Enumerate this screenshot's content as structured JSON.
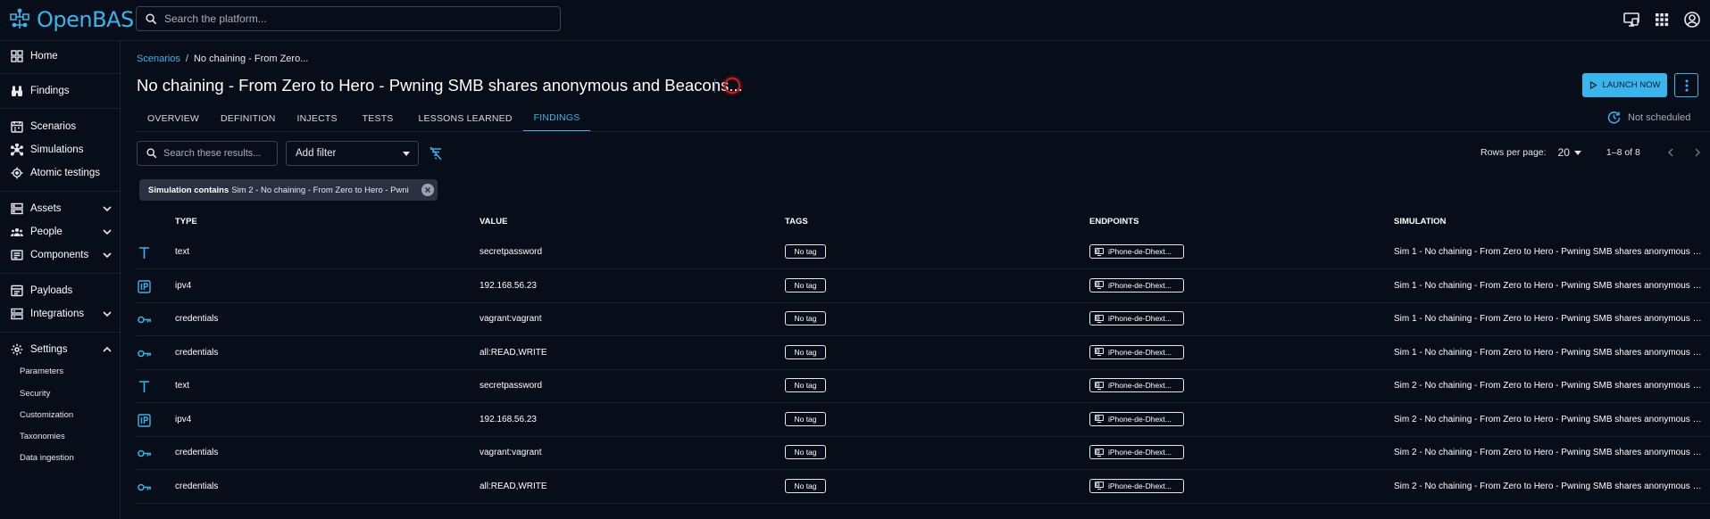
{
  "app": {
    "name": "OpenBAS"
  },
  "search": {
    "placeholder": "Search the platform..."
  },
  "sidebar": {
    "items": [
      {
        "label": "Home"
      },
      {
        "label": "Findings"
      },
      {
        "label": "Scenarios"
      },
      {
        "label": "Simulations"
      },
      {
        "label": "Atomic testings"
      },
      {
        "label": "Assets"
      },
      {
        "label": "People"
      },
      {
        "label": "Components"
      },
      {
        "label": "Payloads"
      },
      {
        "label": "Integrations"
      },
      {
        "label": "Settings"
      }
    ],
    "settings_sub": [
      {
        "label": "Parameters"
      },
      {
        "label": "Security"
      },
      {
        "label": "Customization"
      },
      {
        "label": "Taxonomies"
      },
      {
        "label": "Data ingestion"
      }
    ]
  },
  "breadcrumb": {
    "parent": "Scenarios",
    "current": "No chaining - From Zero..."
  },
  "page": {
    "title": "No chaining - From Zero to Hero - Pwning SMB shares anonymous and Beacons...",
    "launch_label": "LAUNCH NOW",
    "schedule_label": "Not scheduled"
  },
  "tabs": [
    {
      "label": "OVERVIEW"
    },
    {
      "label": "DEFINITION"
    },
    {
      "label": "INJECTS"
    },
    {
      "label": "TESTS"
    },
    {
      "label": "LESSONS LEARNED"
    },
    {
      "label": "FINDINGS",
      "active": true
    }
  ],
  "toolbar": {
    "search_placeholder": "Search these results...",
    "filter_placeholder": "Add filter",
    "rows_per_page_label": "Rows per page:",
    "rows_per_page": "20",
    "range": "1–8 of 8"
  },
  "active_filter": {
    "key": "Simulation contains",
    "value": "Sim 2 - No chaining - From Zero to Hero - Pwni"
  },
  "table": {
    "headers": {
      "type": "TYPE",
      "value": "VALUE",
      "tags": "TAGS",
      "endpoints": "ENDPOINTS",
      "simulation": "SIMULATION"
    },
    "rows": [
      {
        "icon": "text-icon",
        "type": "text",
        "value": "secretpassword",
        "tag": "No tag",
        "endpoint": "iPhone-de-Dhext...",
        "simulation": "Sim 1 - No chaining - From Zero to Hero - Pwning SMB shares anonymous a..."
      },
      {
        "icon": "ip-icon",
        "type": "ipv4",
        "value": "192.168.56.23",
        "tag": "No tag",
        "endpoint": "iPhone-de-Dhext...",
        "simulation": "Sim 1 - No chaining - From Zero to Hero - Pwning SMB shares anonymous a..."
      },
      {
        "icon": "key-icon",
        "type": "credentials",
        "value": "vagrant:vagrant",
        "tag": "No tag",
        "endpoint": "iPhone-de-Dhext...",
        "simulation": "Sim 1 - No chaining - From Zero to Hero - Pwning SMB shares anonymous a..."
      },
      {
        "icon": "key-icon",
        "type": "credentials",
        "value": "all:READ,WRITE",
        "tag": "No tag",
        "endpoint": "iPhone-de-Dhext...",
        "simulation": "Sim 1 - No chaining - From Zero to Hero - Pwning SMB shares anonymous a..."
      },
      {
        "icon": "text-icon",
        "type": "text",
        "value": "secretpassword",
        "tag": "No tag",
        "endpoint": "iPhone-de-Dhext...",
        "simulation": "Sim 2 - No chaining - From Zero to Hero - Pwning SMB shares anonymous a..."
      },
      {
        "icon": "ip-icon",
        "type": "ipv4",
        "value": "192.168.56.23",
        "tag": "No tag",
        "endpoint": "iPhone-de-Dhext...",
        "simulation": "Sim 2 - No chaining - From Zero to Hero - Pwning SMB shares anonymous a..."
      },
      {
        "icon": "key-icon",
        "type": "credentials",
        "value": "vagrant:vagrant",
        "tag": "No tag",
        "endpoint": "iPhone-de-Dhext...",
        "simulation": "Sim 2 - No chaining - From Zero to Hero - Pwning SMB shares anonymous a..."
      },
      {
        "icon": "key-icon",
        "type": "credentials",
        "value": "all:READ,WRITE",
        "tag": "No tag",
        "endpoint": "iPhone-de-Dhext...",
        "simulation": "Sim 2 - No chaining - From Zero to Hero - Pwning SMB shares anonymous a..."
      }
    ]
  },
  "colors": {
    "accent": "#3ab4ec",
    "background": "#070d19",
    "status_ring": "#c9201e"
  }
}
